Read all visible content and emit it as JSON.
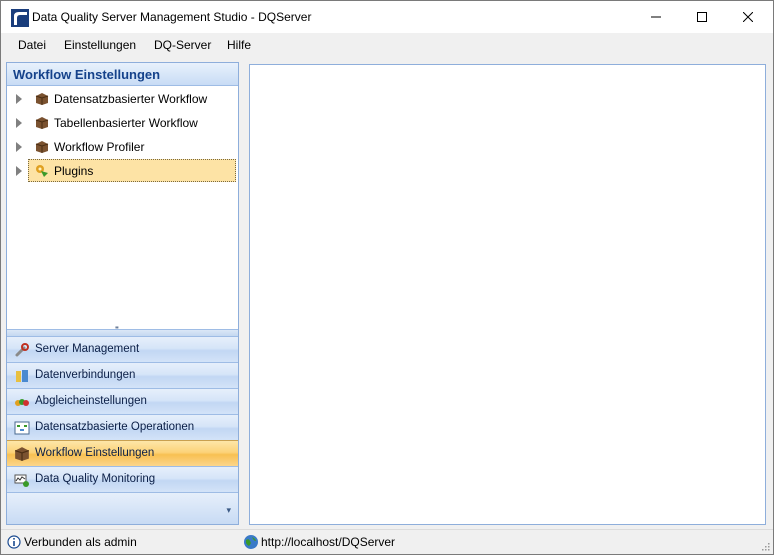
{
  "window": {
    "title": "Data Quality Server Management Studio - DQServer"
  },
  "menu": {
    "items": [
      "Datei",
      "Einstellungen",
      "DQ-Server",
      "Hilfe"
    ]
  },
  "left_panel": {
    "header": "Workflow Einstellungen",
    "tree": [
      {
        "label": "Datensatzbasierter Workflow",
        "icon": "package-icon"
      },
      {
        "label": "Tabellenbasierter Workflow",
        "icon": "package-icon"
      },
      {
        "label": "Workflow Profiler",
        "icon": "package-icon"
      },
      {
        "label": "Plugins",
        "icon": "plugins-icon",
        "selected": true
      }
    ],
    "nav": [
      {
        "label": "Server Management",
        "icon": "wrench-icon"
      },
      {
        "label": "Datenverbindungen",
        "icon": "database-icon"
      },
      {
        "label": "Abgleicheinstellungen",
        "icon": "compare-icon"
      },
      {
        "label": "Datensatzbasierte Operationen",
        "icon": "operations-icon"
      },
      {
        "label": "Workflow Einstellungen",
        "icon": "package-icon",
        "active": true
      },
      {
        "label": "Data Quality Monitoring",
        "icon": "monitor-icon"
      }
    ]
  },
  "status": {
    "connection": "Verbunden als admin",
    "url": "http://localhost/DQServer"
  }
}
